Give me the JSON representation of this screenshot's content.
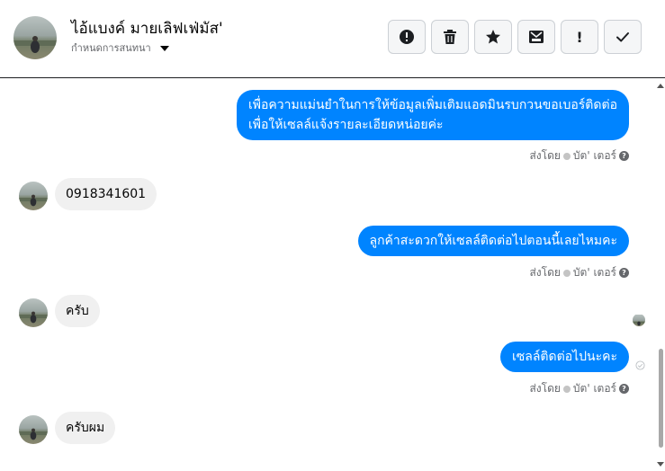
{
  "header": {
    "contact_name": "ไอ้แบงค์ มายเลิฟเฟ่มัส'",
    "assign_label": "กำหนดการสนทนา",
    "toolbar": [
      {
        "icon": "alert-circle-icon",
        "name": "mark-spam-button"
      },
      {
        "icon": "trash-icon",
        "name": "delete-button"
      },
      {
        "icon": "star-icon",
        "name": "star-button"
      },
      {
        "icon": "mark-unread-icon",
        "name": "mark-unread-button"
      },
      {
        "icon": "exclamation-icon",
        "name": "follow-up-button",
        "glyph": "!"
      },
      {
        "icon": "check-icon",
        "name": "mark-done-button"
      }
    ]
  },
  "messages": {
    "m1_line1": "เพื่อความแม่นยำในการให้ข้อมูลเพิ่มเติมแอดมินรบกวนขอเบอร์ติดต่อ",
    "m1_line2": "เพื่อให้เซลล์แจ้งรายละเอียดหน่อยค่ะ",
    "m1_sent_by": "ส่งโดย",
    "m1_sender": "บัต' เตอร์",
    "m2": "0918341601",
    "m3": "ลูกค้าสะดวกให้เซลล์ติดต่อไปตอนนี้เลยไหมคะ",
    "m3_sent_by": "ส่งโดย",
    "m3_sender": "บัต' เตอร์",
    "m4": "ครับ",
    "m5": "เซลล์ติดต่อไปนะคะ",
    "m5_sent_by": "ส่งโดย",
    "m5_sender": "บัต' เตอร์",
    "m6": "ครับผม",
    "help_glyph": "?"
  },
  "colors": {
    "outgoing_bubble": "#0084ff",
    "incoming_bubble": "#f0f0f0",
    "meta_text": "#65676b"
  }
}
